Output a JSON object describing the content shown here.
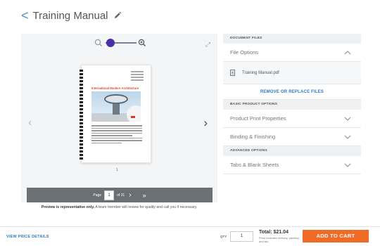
{
  "header": {
    "back_glyph": "<",
    "title": "Training Manual",
    "edit_icon": "pencil-icon"
  },
  "preview": {
    "zoom_level": 0.15,
    "doc_heading": "International Modern Architecture",
    "page_number_below": "1",
    "pagination": {
      "page_label": "Page",
      "current_page": "1",
      "of_label": "of 31",
      "next_glyph": "›",
      "last_glyph": "»"
    },
    "disclaimer_bold": "Preview is representative only.",
    "disclaimer_text": "A team member will review for quality and call you if necessary."
  },
  "options": {
    "document_files_header": "DOCUMENT FILES",
    "file_options_label": "File Options",
    "file_name": "Training Manual.pdf",
    "remove_replace_label": "REMOVE OR REPLACE FILES",
    "basic_header": "BASIC PRODUCT OPTIONS",
    "product_print_label": "Product Print Properties",
    "binding_label": "Binding & Finishing",
    "advanced_header": "ADVANCED OPTIONS",
    "tabs_label": "Tabs & Blank Sheets"
  },
  "footer": {
    "view_price_details": "VIEW PRICE DETAILS",
    "qty_label": "QTY",
    "qty_value": "1",
    "total": "Total: $21.04",
    "total_note": "Price excludes delivery, packing and tax.",
    "add_to_cart": "ADD TO CART"
  },
  "colors": {
    "accent_link": "#2f7cc1",
    "cta": "#f06b25",
    "zoom_knob": "#4b2fa8",
    "doc_heading": "#e0492b"
  }
}
